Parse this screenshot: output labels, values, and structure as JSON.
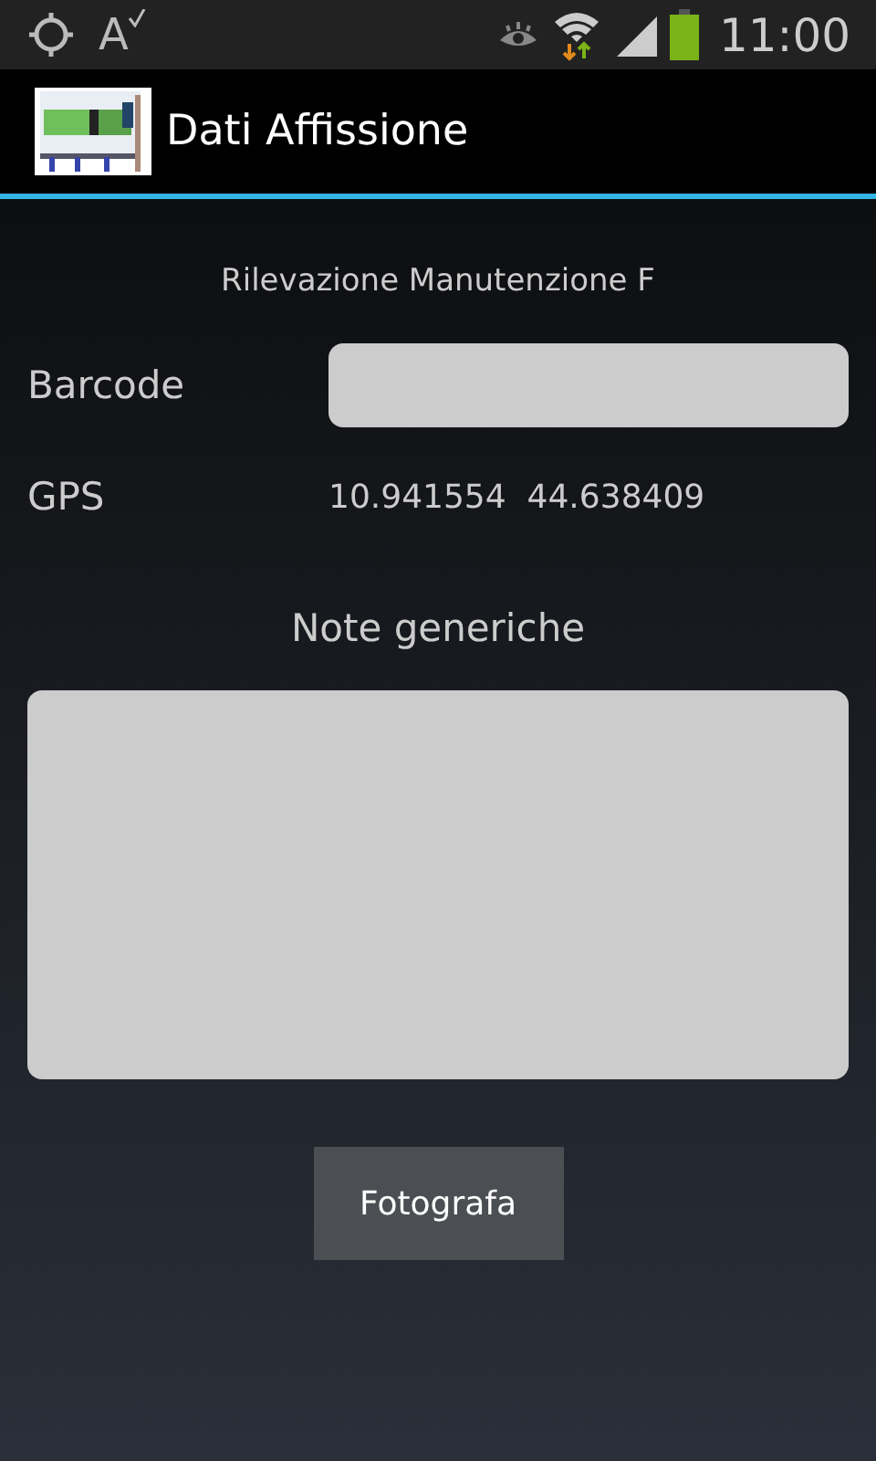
{
  "status_bar": {
    "spellcheck_glyph": "A",
    "time": "11:00"
  },
  "action_bar": {
    "title": "Dati Affissione"
  },
  "form": {
    "heading": "Rilevazione Manutenzione F",
    "barcode": {
      "label": "Barcode"
    },
    "gps": {
      "label": "GPS",
      "value": "10.941554  44.638409"
    },
    "notes": {
      "label": "Note generiche"
    },
    "button": "Fotografa"
  }
}
